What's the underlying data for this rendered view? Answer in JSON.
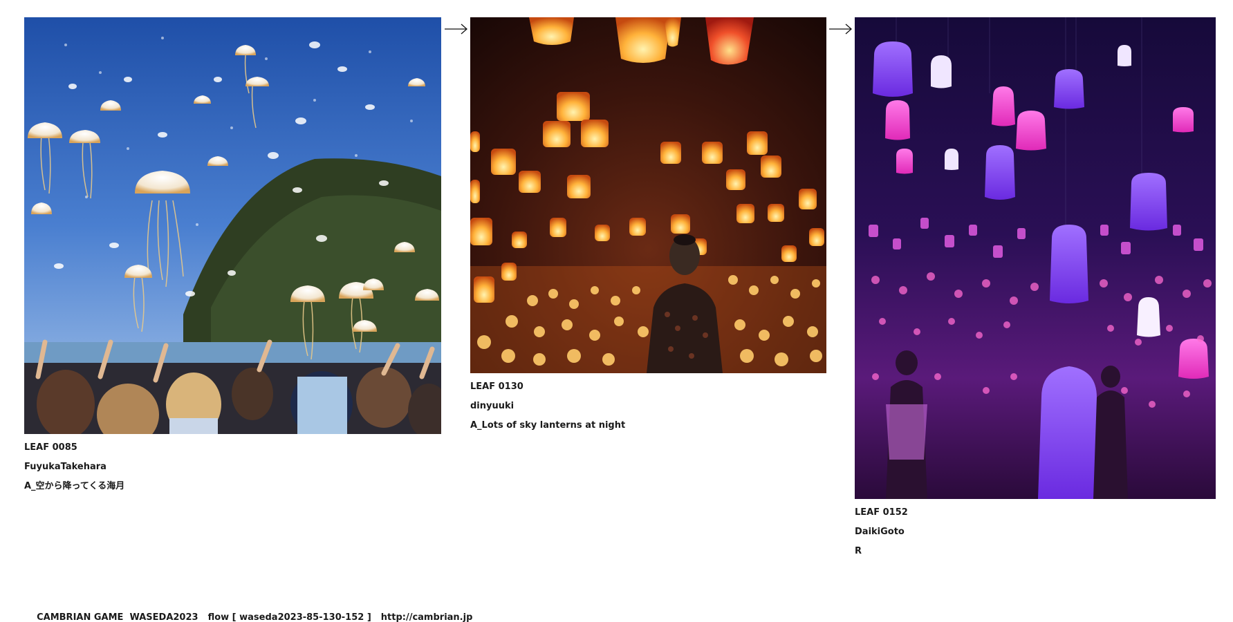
{
  "leaves": [
    {
      "id": "LEAF 0085",
      "author": "FuyukaTakehara",
      "title": "A_空から降ってくる海月",
      "image_subject": "jellyfish falling from the sky over a crowd at the seaside"
    },
    {
      "id": "LEAF 0130",
      "author": "dinyuuki",
      "title": "A_Lots of sky lanterns at night",
      "image_subject": "woman standing among glowing orange sky lanterns at night"
    },
    {
      "id": "LEAF 0152",
      "author": "DaikiGoto",
      "title": "R",
      "image_subject": "room filled with glowing purple and pink hanging lamps"
    }
  ],
  "arrows": [
    "arrow-right-icon",
    "arrow-right-icon"
  ],
  "footer": {
    "game": "CAMBRIAN GAME  WASEDA2023",
    "flow": "flow [ waseda2023-85-130-152 ]",
    "url": "http://cambrian.jp"
  },
  "colors": {
    "background": "#ffffff",
    "text": "#1a1a1a"
  }
}
